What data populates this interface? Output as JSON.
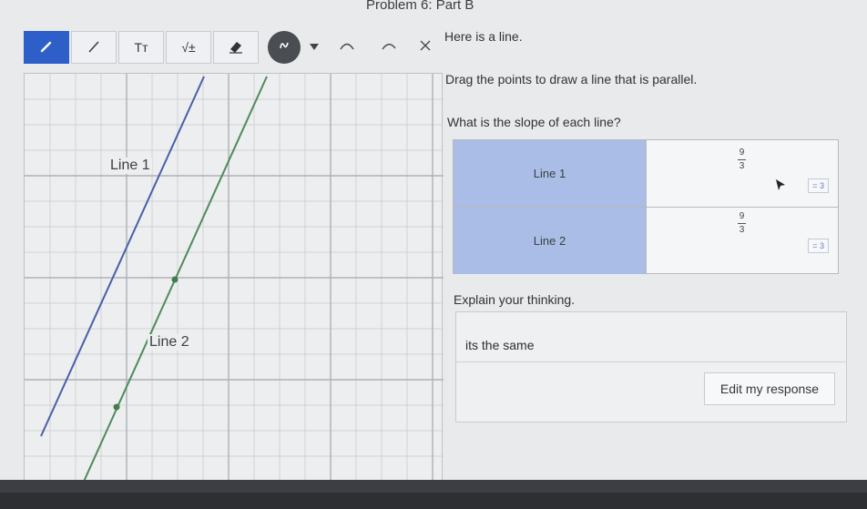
{
  "page": {
    "title": "Problem 6: Part B"
  },
  "toolbar": {
    "tools": [
      {
        "icon": "pencil-icon"
      },
      {
        "icon": "line-segment-icon"
      },
      {
        "icon": "text-tool-icon",
        "label": "Tт"
      },
      {
        "icon": "math-tool-icon",
        "label": "√±"
      },
      {
        "icon": "eraser-icon"
      },
      {
        "icon": "color-picker-icon"
      }
    ],
    "undo_icon": "undo-icon",
    "redo_icon": "redo-icon",
    "close_icon": "close-icon"
  },
  "graph": {
    "line1_label": "Line 1",
    "line2_label": "Line 2",
    "colors": {
      "line1": "#4a5fa8",
      "line2": "#4f8a5b",
      "point": "#3f7d4d"
    }
  },
  "prompt": {
    "intro": "Here is a line.",
    "instruction": "Drag the points to draw a line that is parallel.",
    "question": "What is the slope of each line?"
  },
  "slope_table": {
    "rows": [
      {
        "name": "Line 1",
        "numerator": "9",
        "denominator": "3",
        "result": "= 3"
      },
      {
        "name": "Line 2",
        "numerator": "9",
        "denominator": "3",
        "result": "= 3"
      }
    ]
  },
  "explain": {
    "label": "Explain your thinking.",
    "answer": "its the same",
    "edit_button": "Edit my response"
  }
}
